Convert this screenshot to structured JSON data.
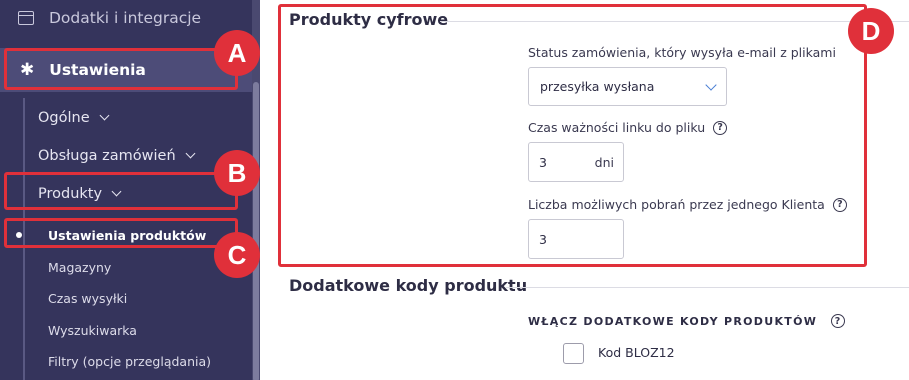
{
  "sidebar": {
    "integrations_label": "Dodatki i integracje",
    "settings_label": "Ustawienia",
    "submenu": {
      "general": "Ogólne",
      "orders": "Obsługa zamówień",
      "products": "Produkty"
    },
    "product_items": {
      "active": "Ustawienia produktów",
      "warehouses": "Magazyny",
      "shipping_time": "Czas wysyłki",
      "search": "Wyszukiwarka",
      "filters": "Filtry (opcje przeglądania)"
    }
  },
  "badges": {
    "a": "A",
    "b": "B",
    "c": "C",
    "d": "D"
  },
  "digital_products": {
    "title": "Produkty cyfrowe",
    "status_label": "Status zamówienia, który wysyła e-mail z plikami",
    "status_value": "przesyłka wysłana",
    "link_validity_label": "Czas ważności linku do pliku",
    "link_validity_value": "3",
    "link_validity_unit": "dni",
    "downloads_label": "Liczba możliwych pobrań przez jednego Klienta",
    "downloads_value": "3",
    "help_glyph": "?"
  },
  "extra_codes": {
    "title": "Dodatkowe kody produktu",
    "enable_label": "WŁĄCZ DODATKOWE KODY PRODUKTÓW",
    "help_glyph": "?",
    "checkbox_label": "Kod BLOZ12"
  },
  "colors": {
    "sidebar_bg": "#35345c",
    "sidebar_active_bg": "#4d4c78",
    "highlight": "#e0303a",
    "select_chevron": "#4a7fd4"
  },
  "icons": {
    "integrations": "window-icon",
    "settings": "gear-icon"
  }
}
